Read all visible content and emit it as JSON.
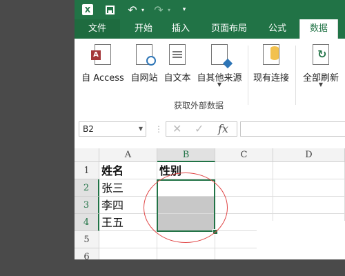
{
  "quick_access": {
    "app_icon": "excel-icon",
    "app_letter": "X",
    "save_icon": "save-icon",
    "undo_icon": "undo-icon",
    "redo_icon": "redo-icon",
    "more_icon": "customize-quick-access-icon"
  },
  "tabs": [
    {
      "label": "文件"
    },
    {
      "label": "开始"
    },
    {
      "label": "插入"
    },
    {
      "label": "页面布局"
    },
    {
      "label": "公式"
    },
    {
      "label": "数据"
    }
  ],
  "ribbon": {
    "buttons": [
      {
        "label": "自 Access",
        "icon": "access-icon"
      },
      {
        "label": "自网站",
        "icon": "web-icon"
      },
      {
        "label": "自文本",
        "icon": "text-file-icon"
      },
      {
        "label": "自其他来源",
        "icon": "other-sources-icon"
      },
      {
        "label": "现有连接",
        "icon": "existing-connections-icon"
      },
      {
        "label": "全部刷新",
        "icon": "refresh-all-icon"
      }
    ],
    "group_label": "获取外部数据"
  },
  "formula_bar": {
    "name_box": "B2",
    "cancel_glyph": "✕",
    "enter_glyph": "✓",
    "fx_label": "fx",
    "formula": ""
  },
  "sheet": {
    "columns": [
      "A",
      "B",
      "C",
      "D"
    ],
    "rows": [
      "1",
      "2",
      "3",
      "4",
      "5",
      "6"
    ],
    "cells": {
      "A1": "姓名",
      "B1": "性别",
      "A2": "张三",
      "A3": "李四",
      "A4": "王五"
    },
    "selected_cell": "B2"
  },
  "colors": {
    "accent": "#217346",
    "annotation_circle": "#e04646",
    "shaded_cells": "#c8c8c8"
  }
}
